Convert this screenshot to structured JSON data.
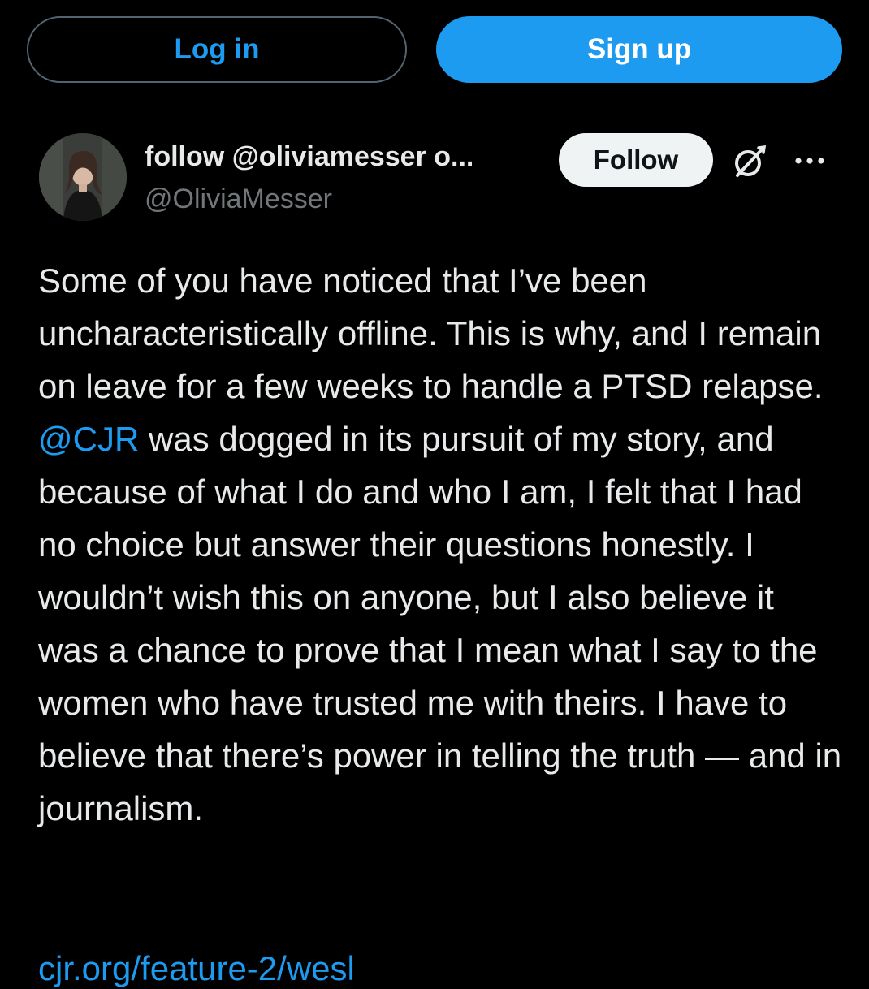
{
  "auth": {
    "login_label": "Log in",
    "signup_label": "Sign up"
  },
  "tweet": {
    "display_name": "follow @oliviamesser o...",
    "handle": "@OliviaMesser",
    "follow_label": "Follow",
    "body_before_mention": "Some of you have noticed that I’ve been uncharacteristically offline. This is why, and I remain on leave for a few weeks to handle a PTSD relapse. ",
    "mention": "@CJR",
    "body_after_mention": " was dogged in its pursuit of my story, and because of what I do and who I am, I felt that I had no choice but answer their questions honestly. I wouldn’t wish this on anyone, but I also believe it was a chance to prove that I mean what I say to the women who have trusted me with theirs. I have to believe that there’s power in telling the truth — and in journalism.",
    "link_text": "cjr.org/feature-2/wesl"
  },
  "icons": {
    "grok": "grok-icon",
    "more": "more-options-icon"
  },
  "colors": {
    "background": "#000000",
    "accent": "#1d9bf0",
    "text": "#e7e9ea",
    "muted": "#71767b",
    "follow_bg": "#eff3f4"
  }
}
